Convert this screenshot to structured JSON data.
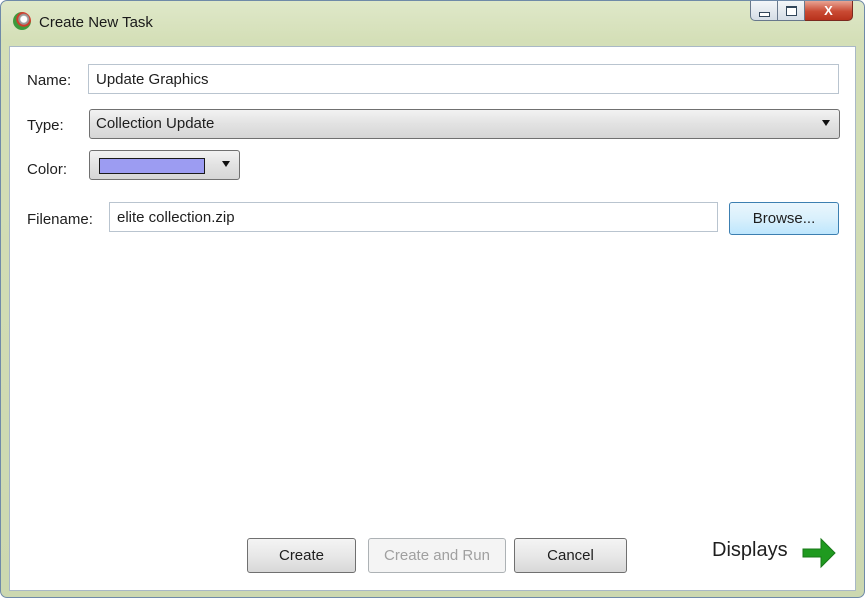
{
  "window": {
    "title": "Create New Task",
    "controls": {
      "minimize": "minimize",
      "maximize": "maximize",
      "close": "X"
    }
  },
  "form": {
    "name": {
      "label": "Name:",
      "value": "Update Graphics"
    },
    "type": {
      "label": "Type:",
      "value": "Collection Update"
    },
    "color": {
      "label": "Color:",
      "value": "#9c9cf2"
    },
    "filename": {
      "label": "Filename:",
      "value": "elite collection.zip",
      "browse_label": "Browse..."
    }
  },
  "buttons": {
    "create": "Create",
    "create_and_run": "Create and Run",
    "cancel": "Cancel"
  },
  "displays": {
    "label": "Displays",
    "icon": "right-arrow-icon",
    "color": "#1f9a1f"
  }
}
